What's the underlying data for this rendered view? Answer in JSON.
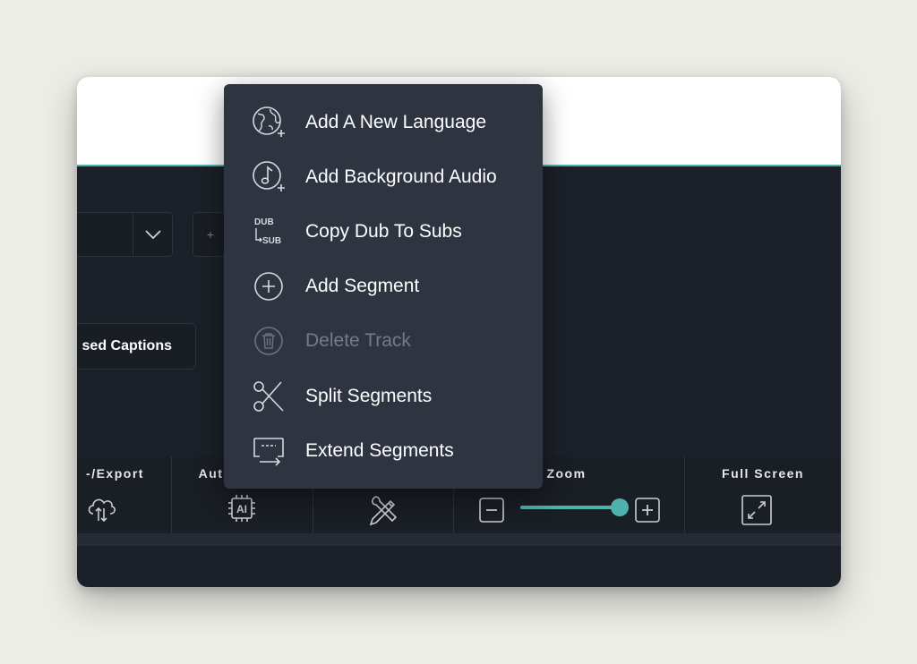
{
  "toolbar": {
    "import_export_label": "-/Export",
    "auto_label": "Aut",
    "zoom_label": "Zoom",
    "full_screen_label": "Full Screen",
    "ai_chip_text": "AI",
    "zoom_level": 0.85
  },
  "captions_button_label": "sed Captions",
  "small_plus": "+",
  "context_menu": {
    "items": [
      {
        "label": "Add A New Language",
        "icon": "globe-plus-icon",
        "enabled": true
      },
      {
        "label": "Add Background Audio",
        "icon": "music-note-plus-icon",
        "enabled": true
      },
      {
        "label": "Copy Dub To Subs",
        "icon": "dub-to-sub-icon",
        "enabled": true
      },
      {
        "label": "Add Segment",
        "icon": "plus-circle-icon",
        "enabled": true
      },
      {
        "label": "Delete Track",
        "icon": "trash-icon",
        "enabled": false
      },
      {
        "label": "Split Segments",
        "icon": "scissors-icon",
        "enabled": true
      },
      {
        "label": "Extend Segments",
        "icon": "extend-segments-icon",
        "enabled": true
      }
    ],
    "dub_icon_top": "DUB",
    "dub_icon_bottom": "SUB"
  },
  "colors": {
    "accent": "#4fb3ad",
    "menu_bg": "#2e3440",
    "window_bg": "#1c2028",
    "disabled_text": "#747b86"
  }
}
